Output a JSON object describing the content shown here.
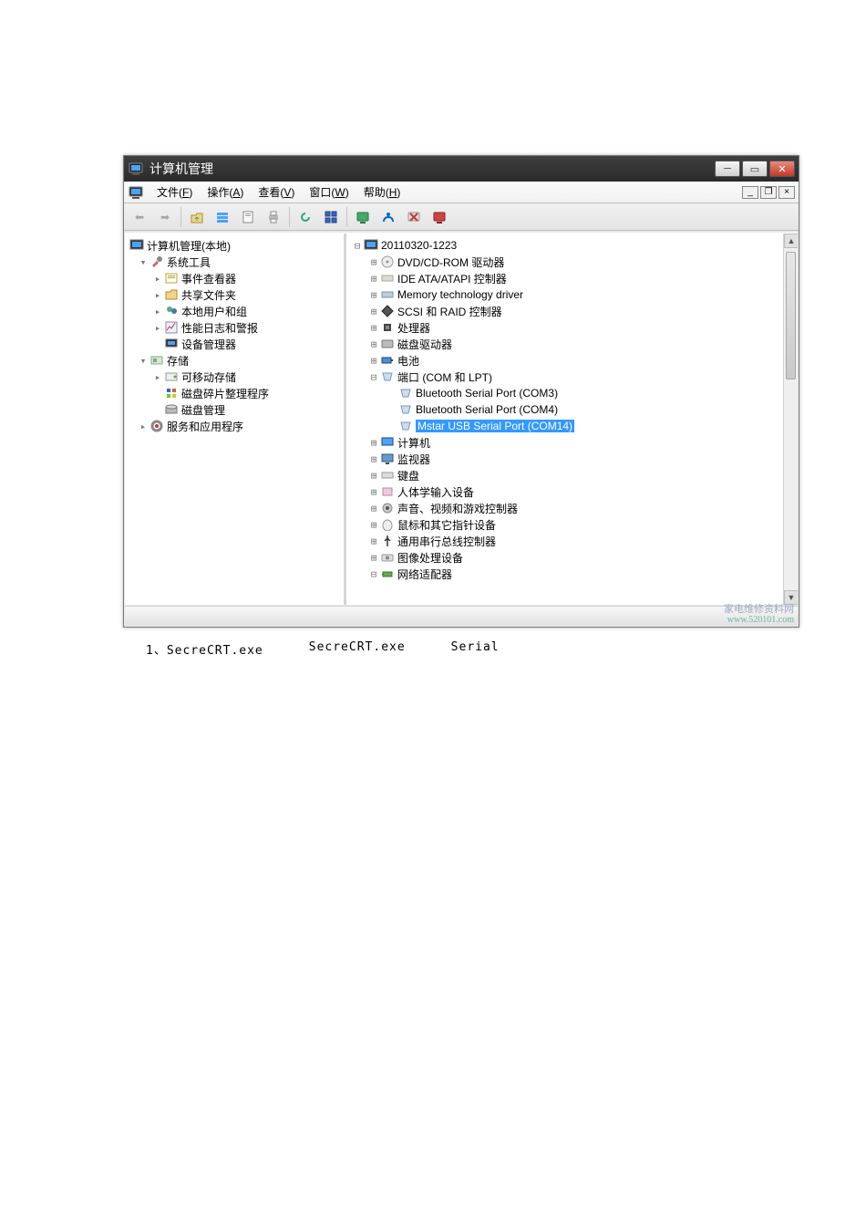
{
  "window": {
    "title": "计算机管理",
    "btn_min": "─",
    "btn_max": "▭",
    "btn_close": "✕"
  },
  "mdi": {
    "file": {
      "pre": "文件(",
      "hot": "F",
      "post": ")"
    },
    "action": {
      "pre": "操作(",
      "hot": "A",
      "post": ")"
    },
    "view": {
      "pre": "查看(",
      "hot": "V",
      "post": ")"
    },
    "window": {
      "pre": "窗口(",
      "hot": "W",
      "post": ")"
    },
    "help": {
      "pre": "帮助(",
      "hot": "H",
      "post": ")"
    },
    "min": "_",
    "restore": "❐",
    "close": "×"
  },
  "toolbar": {
    "back": "⬅",
    "fwd": "➡",
    "up": "⤴",
    "views": "☰",
    "prop": "📄",
    "print": "🖨",
    "refresh": "⟳",
    "dev": "▦",
    "people": "👥",
    "net": "📶",
    "x": "✖",
    "scan": "🔍"
  },
  "left": {
    "root": "计算机管理(本地)",
    "sys": "系统工具",
    "event": "事件查看器",
    "shared": "共享文件夹",
    "users": "本地用户和组",
    "perf": "性能日志和警报",
    "devmgr": "设备管理器",
    "store": "存储",
    "removable": "可移动存储",
    "defrag": "磁盘碎片整理程序",
    "diskmgmt": "磁盘管理",
    "svc": "服务和应用程序"
  },
  "right": {
    "root": "20110320-1223",
    "n0": "DVD/CD-ROM 驱动器",
    "n1": "IDE ATA/ATAPI 控制器",
    "n2": "Memory technology driver",
    "n3": "SCSI 和 RAID 控制器",
    "n4": "处理器",
    "n5": "磁盘驱动器",
    "n6": "电池",
    "n7": "端口 (COM 和 LPT)",
    "n7a": "Bluetooth Serial Port (COM3)",
    "n7b": "Bluetooth Serial Port (COM4)",
    "n7c": "Mstar USB Serial Port (COM14)",
    "n8": "计算机",
    "n9": "监视器",
    "n10": "键盘",
    "n11": "人体学输入设备",
    "n12": "声音、视频和游戏控制器",
    "n13": "鼠标和其它指针设备",
    "n14": "通用串行总线控制器",
    "n15": "图像处理设备",
    "n16": "网络适配器"
  },
  "watermark": {
    "l1": "家电维修资料网",
    "l2": "www.520101.com"
  },
  "caption": {
    "seg1": "1、SecreCRT.exe",
    "seg2": "SecreCRT.exe",
    "seg3": "Serial"
  }
}
